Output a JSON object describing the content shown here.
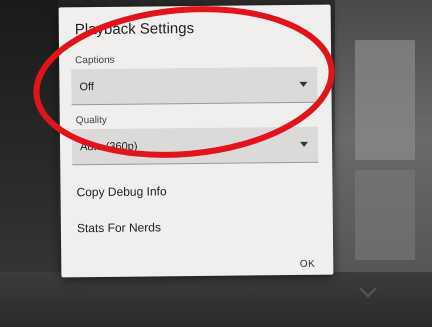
{
  "dialog": {
    "title": "Playback Settings",
    "captions": {
      "label": "Captions",
      "value": "Off"
    },
    "quality": {
      "label": "Quality",
      "value": "Auto (360p)"
    },
    "actions": [
      {
        "label": "Copy Debug Info"
      },
      {
        "label": "Stats For Nerds"
      }
    ],
    "ok_label": "OK"
  },
  "colors": {
    "annotation": "#e1141b",
    "dialog_bg": "#f1efed",
    "select_bg": "#dcdad8"
  },
  "icons": {
    "dropdown": "chevron-down-icon"
  }
}
